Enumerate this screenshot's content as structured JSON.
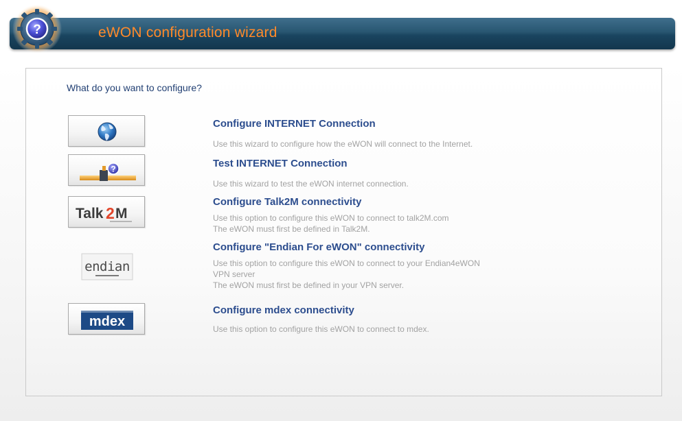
{
  "header": {
    "title": "eWON configuration wizard",
    "icon": "help-question-icon"
  },
  "main": {
    "question": "What do you want to configure?",
    "options": [
      {
        "icon": "globe-icon",
        "title": "Configure INTERNET Connection",
        "desc": [
          "Use this wizard to configure how the eWON will connect to the Internet."
        ]
      },
      {
        "icon": "network-test-icon",
        "title": "Test INTERNET Connection",
        "desc": [
          "Use this wizard to test the eWON internet connection."
        ]
      },
      {
        "icon": "talk2m-logo",
        "logo_text": "Talk2M",
        "title": "Configure Talk2M connectivity",
        "desc": [
          "Use this option to configure this eWON to connect to talk2M.com",
          "The eWON must first be defined in Talk2M."
        ]
      },
      {
        "icon": "endian-logo",
        "logo_text": "endian",
        "title": "Configure \"Endian For eWON\" connectivity",
        "desc": [
          "Use this option to configure this eWON to connect to your Endian4eWON",
          "VPN server",
          "The eWON must first be defined in your VPN server."
        ]
      },
      {
        "icon": "mdex-logo",
        "logo_text": "mdex",
        "title": "Configure mdex connectivity",
        "desc": [
          "Use this option to configure this eWON to connect to mdex."
        ]
      }
    ]
  },
  "colors": {
    "header_bg": "#1f4a66",
    "header_title": "#ff8a2a",
    "question_text": "#213f73",
    "option_title": "#2c4d8e",
    "option_desc": "#a2a2a2"
  }
}
